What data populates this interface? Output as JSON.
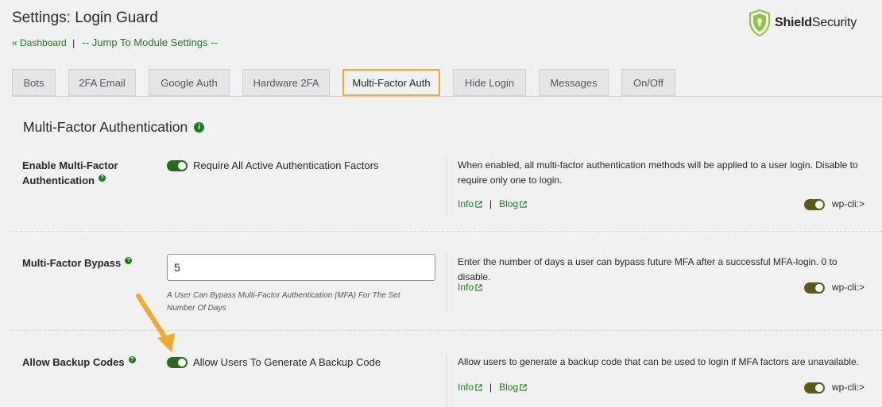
{
  "header": {
    "title": "Settings: Login Guard",
    "dashboard_link": "« Dashboard",
    "separator": "|",
    "jump_link": "-- Jump To Module Settings --",
    "brand_bold": "Shield",
    "brand_rest": "Security"
  },
  "tabs": [
    {
      "label": "Bots"
    },
    {
      "label": "2FA Email"
    },
    {
      "label": "Google Auth"
    },
    {
      "label": "Hardware 2FA"
    },
    {
      "label": "Multi-Factor Auth",
      "active": true
    },
    {
      "label": "Hide Login"
    },
    {
      "label": "Messages"
    },
    {
      "label": "On/Off"
    }
  ],
  "section": {
    "title": "Multi-Factor Authentication",
    "info_glyph": "i",
    "help_glyph": "?"
  },
  "rows": [
    {
      "label_line1": "Enable Multi-Factor",
      "label_line2": "Authentication",
      "control_label": "Require All Active Authentication Factors",
      "toggle_on": true,
      "description": "When enabled, all multi-factor authentication methods will be applied to a user login. Disable to require only one to login.",
      "info_link": "Info",
      "blog_link": "Blog",
      "wpcli": "wp-cli:>"
    },
    {
      "label": "Multi-Factor Bypass",
      "input_value": "5",
      "hint": "A User Can Bypass Multi-Factor Authentication (MFA) For The Set Number Of Days",
      "description": "Enter the number of days a user can bypass future MFA after a successful MFA-login. 0 to disable.",
      "info_link": "Info",
      "wpcli": "wp-cli:>"
    },
    {
      "label": "Allow Backup Codes",
      "control_label": "Allow Users To Generate A Backup Code",
      "toggle_on": true,
      "description": "Allow users to generate a backup code that can be used to login if MFA factors are unavailable.",
      "info_link": "Info",
      "blog_link": "Blog",
      "wpcli": "wp-cli:>"
    }
  ],
  "colors": {
    "accent_green": "#1a7d1a",
    "toggle_green": "#2b6a1e",
    "toggle_olive": "#5c5a1a",
    "active_tab_border": "#f0a830",
    "arrow": "#f0a830"
  }
}
